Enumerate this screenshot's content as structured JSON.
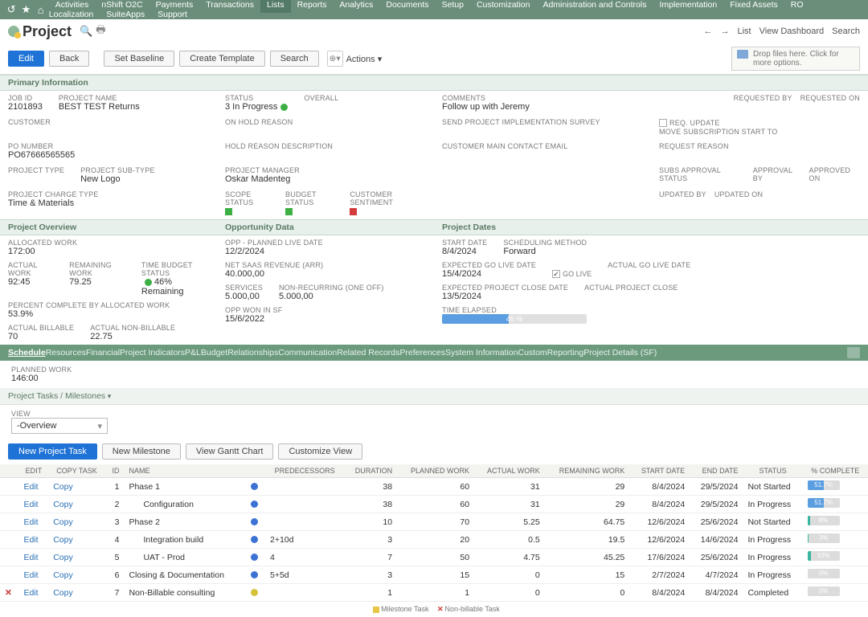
{
  "topnav": {
    "items": [
      "Activities",
      "nShift O2C",
      "Payments",
      "Transactions",
      "Lists",
      "Reports",
      "Analytics",
      "Documents",
      "Setup",
      "Customization",
      "Administration and Controls",
      "Implementation",
      "Fixed Assets",
      "RO Localization",
      "SuiteApps",
      "Support"
    ],
    "active_index": 4
  },
  "header": {
    "title": "Project",
    "right": [
      "List",
      "View Dashboard",
      "Search"
    ]
  },
  "toolbar": {
    "edit": "Edit",
    "back": "Back",
    "set_baseline": "Set Baseline",
    "create_template": "Create Template",
    "search": "Search",
    "actions": "Actions",
    "dropzone": "Drop files here. Click for more options."
  },
  "sections": {
    "primary": "Primary Information",
    "overview": "Project Overview",
    "oppdata": "Opportunity Data",
    "dates": "Project Dates"
  },
  "primary": {
    "job_id_lbl": "JOB ID",
    "job_id": "2101893",
    "proj_name_lbl": "PROJECT NAME",
    "proj_name": "BEST TEST Returns",
    "status_lbl": "STATUS",
    "status": "3 In Progress",
    "overall_lbl": "OVERALL",
    "comments_lbl": "COMMENTS",
    "comments": "Follow up with Jeremy",
    "requested_by_lbl": "REQUESTED BY",
    "requested_on_lbl": "REQUESTED ON",
    "customer_lbl": "CUSTOMER",
    "onhold_lbl": "ON HOLD REASON",
    "send_impl_lbl": "SEND PROJECT IMPLEMENTATION SURVEY",
    "requpd_lbl": "REQ. UPDATE",
    "movesub_lbl": "MOVE SUBSCRIPTION START TO",
    "po_lbl": "PO NUMBER",
    "po": "PO67666565565",
    "holddesc_lbl": "HOLD REASON DESCRIPTION",
    "custemail_lbl": "CUSTOMER MAIN CONTACT EMAIL",
    "reqreason_lbl": "REQUEST REASON",
    "projtype_lbl": "PROJECT TYPE",
    "projsubtype_lbl": "PROJECT SUB-TYPE",
    "projsubtype": "New Logo",
    "pm_lbl": "PROJECT MANAGER",
    "pm": "Oskar Madenteg",
    "subs_lbl": "SUBS APPROVAL STATUS",
    "appby_lbl": "APPROVAL BY",
    "appon_lbl": "APPROVED ON",
    "charge_lbl": "PROJECT CHARGE TYPE",
    "charge": "Time & Materials",
    "scope_lbl": "SCOPE STATUS",
    "budget_lbl": "BUDGET STATUS",
    "sentiment_lbl": "CUSTOMER SENTIMENT",
    "updby_lbl": "UPDATED BY",
    "updon_lbl": "UPDATED ON"
  },
  "overview": {
    "alloc_lbl": "ALLOCATED WORK",
    "alloc": "172:00",
    "actual_lbl": "ACTUAL WORK",
    "actual": "92:45",
    "remain_lbl": "REMAINING WORK",
    "remain": "79.25",
    "tbs_lbl": "TIME BUDGET STATUS",
    "tbs": "46% Remaining",
    "pcbaw_lbl": "PERCENT COMPLETE BY ALLOCATED WORK",
    "pcbaw": "53.9%",
    "abill_lbl": "ACTUAL BILLABLE",
    "abill": "70",
    "anbill_lbl": "ACTUAL NON-BILLABLE",
    "anbill": "22.75"
  },
  "opp": {
    "planned_lbl": "OPP - PLANNED LIVE DATE",
    "planned": "12/2/2024",
    "arr_lbl": "NET SAAS REVENUE (ARR)",
    "arr": "40.000,00",
    "services_lbl": "SERVICES",
    "services": "5.000,00",
    "nrone_lbl": "NON-RECURRING (ONE OFF)",
    "nrone": "5.000,00",
    "won_lbl": "OPP WON IN SF",
    "won": "15/6/2022"
  },
  "dates": {
    "start_lbl": "START DATE",
    "start": "8/4/2024",
    "sched_lbl": "SCHEDULING METHOD",
    "sched": "Forward",
    "egl_lbl": "EXPECTED GO LIVE DATE",
    "egl": "15/4/2024",
    "golive_lbl": "GO LIVE",
    "agl_lbl": "ACTUAL GO LIVE DATE",
    "epc_lbl": "EXPECTED PROJECT CLOSE DATE",
    "epc": "13/5/2024",
    "apc_lbl": "ACTUAL PROJECT CLOSE",
    "elapsed_lbl": "TIME ELAPSED",
    "elapsed_pct": 46,
    "elapsed_txt": "46 %"
  },
  "tabs": [
    "Schedule",
    "Resources",
    "Financial",
    "Project Indicators",
    "P&L",
    "Budget",
    "Relationships",
    "Communication",
    "Related Records",
    "Preferences",
    "System Information",
    "Custom",
    "Reporting",
    "Project Details (SF)"
  ],
  "tabs_active": 0,
  "planned": {
    "lbl": "PLANNED WORK",
    "val": "146:00"
  },
  "tasks_section": "Project Tasks / Milestones",
  "view_lbl": "VIEW",
  "view": "-Overview",
  "task_btns": {
    "new_task": "New Project Task",
    "new_ms": "New Milestone",
    "gantt": "View Gantt Chart",
    "custview": "Customize View"
  },
  "task_cols": [
    "",
    "EDIT",
    "COPY TASK",
    "ID",
    "NAME",
    "",
    "PREDECESSORS",
    "DURATION",
    "PLANNED WORK",
    "ACTUAL WORK",
    "REMAINING WORK",
    "START DATE",
    "END DATE",
    "STATUS",
    "% COMPLETE"
  ],
  "tasks": [
    {
      "id": "1",
      "name": "Phase 1",
      "indent": 0,
      "dot": "blue",
      "pred": "",
      "dur": "38",
      "pw": "60",
      "aw": "31",
      "rw": "29",
      "sd": "8/4/2024",
      "ed": "29/5/2024",
      "st": "Not Started",
      "pct": 51.7,
      "pcttxt": "51.7%",
      "pcol": "blue"
    },
    {
      "id": "2",
      "name": "Configuration",
      "indent": 1,
      "dot": "blue",
      "pred": "",
      "dur": "38",
      "pw": "60",
      "aw": "31",
      "rw": "29",
      "sd": "8/4/2024",
      "ed": "29/5/2024",
      "st": "In Progress",
      "pct": 51.7,
      "pcttxt": "51.7%",
      "pcol": "blue"
    },
    {
      "id": "3",
      "name": "Phase 2",
      "indent": 0,
      "dot": "blue",
      "pred": "",
      "dur": "10",
      "pw": "70",
      "aw": "5.25",
      "rw": "64.75",
      "sd": "12/6/2024",
      "ed": "25/6/2024",
      "st": "Not Started",
      "pct": 8,
      "pcttxt": "8%",
      "pcol": "teal"
    },
    {
      "id": "4",
      "name": "Integration build",
      "indent": 1,
      "dot": "blue",
      "pred": "2+10d",
      "dur": "3",
      "pw": "20",
      "aw": "0.5",
      "rw": "19.5",
      "sd": "12/6/2024",
      "ed": "14/6/2024",
      "st": "In Progress",
      "pct": 3,
      "pcttxt": "3%",
      "pcol": "teal"
    },
    {
      "id": "5",
      "name": "UAT - Prod",
      "indent": 1,
      "dot": "blue",
      "pred": "4",
      "dur": "7",
      "pw": "50",
      "aw": "4.75",
      "rw": "45.25",
      "sd": "17/6/2024",
      "ed": "25/6/2024",
      "st": "In Progress",
      "pct": 10,
      "pcttxt": "10%",
      "pcol": "teal"
    },
    {
      "id": "6",
      "name": "Closing & Documentation",
      "indent": 0,
      "dot": "blue",
      "pred": "5+5d",
      "dur": "3",
      "pw": "15",
      "aw": "0",
      "rw": "15",
      "sd": "2/7/2024",
      "ed": "4/7/2024",
      "st": "In Progress",
      "pct": 0,
      "pcttxt": "0%",
      "pcol": "teal"
    },
    {
      "id": "7",
      "name": "Non-Billable consulting",
      "indent": 0,
      "dot": "yellow",
      "pred": "",
      "dur": "1",
      "pw": "1",
      "aw": "0",
      "rw": "0",
      "sd": "8/4/2024",
      "ed": "8/4/2024",
      "st": "Completed",
      "pct": 0,
      "pcttxt": "0%",
      "pcol": "teal",
      "del": true
    }
  ],
  "task_edit": "Edit",
  "task_copy": "Copy",
  "legend": {
    "ms": "Milestone Task",
    "nb": "Non-billable Task"
  }
}
